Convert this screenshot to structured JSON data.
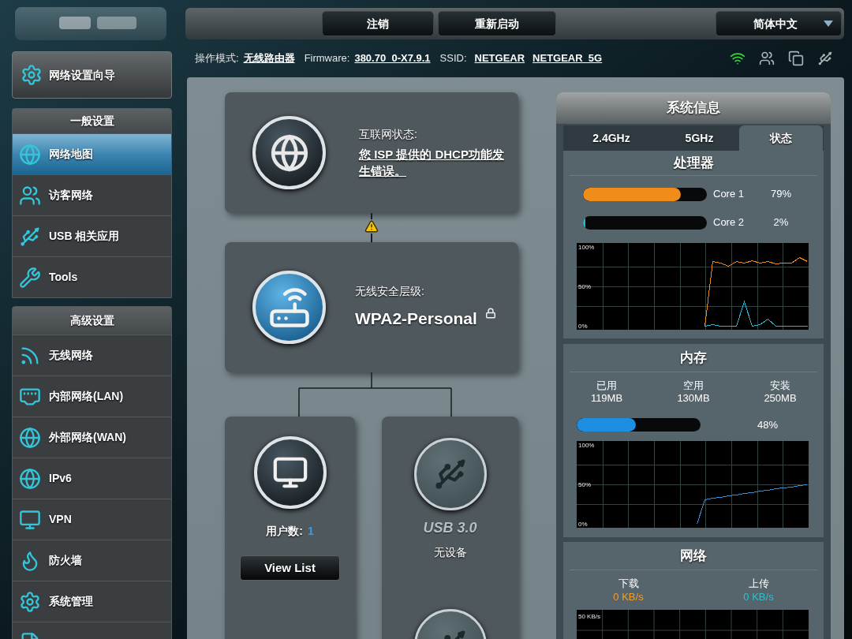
{
  "header": {
    "buttons": [
      "注销",
      "重新启动"
    ],
    "language": "简体中文"
  },
  "info_bar": {
    "mode_label": "操作模式:",
    "mode": "无线路由器",
    "firmware_label": "Firmware:",
    "firmware": "380.70_0-X7.9.1",
    "ssid_label": "SSID:",
    "ssids": [
      "NETGEAR",
      "NETGEAR_5G"
    ],
    "status_icons": [
      {
        "kind": "wifi",
        "active": true
      },
      {
        "kind": "clients",
        "active": false
      },
      {
        "kind": "devices",
        "active": false
      },
      {
        "kind": "usb",
        "active": false
      }
    ]
  },
  "sidebar": {
    "wizard": "网络设置向导",
    "sections": [
      {
        "title": "一般设置",
        "items": [
          {
            "kind": "map",
            "label": "网络地图",
            "selected": true
          },
          {
            "kind": "guest",
            "label": "访客网络",
            "selected": false
          },
          {
            "kind": "usb",
            "label": "USB 相关应用",
            "selected": false
          },
          {
            "kind": "tools",
            "label": "Tools",
            "selected": false
          }
        ]
      },
      {
        "title": "高级设置",
        "items": [
          {
            "kind": "wireless",
            "label": "无线网络",
            "selected": false
          },
          {
            "kind": "lan",
            "label": "内部网络(LAN)",
            "selected": false
          },
          {
            "kind": "wan",
            "label": "外部网络(WAN)",
            "selected": false
          },
          {
            "kind": "ipv6",
            "label": "IPv6",
            "selected": false
          },
          {
            "kind": "vpn",
            "label": "VPN",
            "selected": false
          },
          {
            "kind": "firewall",
            "label": "防火墙",
            "selected": false
          },
          {
            "kind": "admin",
            "label": "系统管理",
            "selected": false
          },
          {
            "kind": "log",
            "selected": false
          }
        ]
      }
    ]
  },
  "network_map": {
    "internet": {
      "label": "互联网状态:",
      "status": "您 ISP 提供的 DHCP功能发生错误。",
      "warning": true
    },
    "router": {
      "label": "无线安全层级:",
      "security": "WPA2-Personal",
      "locked": true
    },
    "clients": {
      "label": "用户数:",
      "count": "1",
      "button": "View List"
    },
    "usb_ports": [
      {
        "kind": "usb",
        "title": "USB 3.0",
        "status": "无设备"
      },
      {
        "kind": "usb"
      }
    ]
  },
  "system_info": {
    "title": "系统信息",
    "tabs": [
      {
        "label": "2.4GHz",
        "selected": false
      },
      {
        "label": "5GHz",
        "selected": false
      },
      {
        "label": "状态",
        "selected": true
      }
    ],
    "cpu": {
      "title": "处理器",
      "cores": [
        {
          "name": "Core 1",
          "level": 0.79,
          "reading": "79%",
          "color": "#f08c1a"
        },
        {
          "name": "Core 2",
          "level": 0.02,
          "reading": "2%",
          "color": "#2ab8d0"
        }
      ],
      "chart_data": {
        "type": "line",
        "grid": true,
        "ylim": [
          -5,
          105
        ],
        "yticks": [
          {
            "value": 0,
            "label": "0%"
          },
          {
            "value": 50,
            "label": "50%"
          },
          {
            "value": 100,
            "label": "100%"
          }
        ],
        "series": [
          {
            "color": "#f08c1a",
            "values": [
              null,
              null,
              null,
              null,
              null,
              null,
              null,
              null,
              null,
              null,
              null,
              null,
              null,
              null,
              null,
              null,
              0,
              82,
              80,
              76,
              82,
              80,
              83,
              80,
              82,
              79,
              80,
              80,
              87,
              82
            ]
          },
          {
            "color": "#2ab8d0",
            "values": [
              null,
              null,
              null,
              null,
              null,
              null,
              null,
              null,
              null,
              null,
              null,
              null,
              null,
              null,
              null,
              null,
              0,
              2,
              0,
              0,
              0,
              31,
              0,
              2,
              9,
              0,
              0,
              0,
              0,
              0
            ]
          }
        ]
      }
    },
    "memory": {
      "title": "内存",
      "stats": [
        {
          "label": "已用",
          "value": "119MB"
        },
        {
          "label": "空用",
          "value": "130MB"
        },
        {
          "label": "安装",
          "value": "250MB"
        }
      ],
      "level": 0.48,
      "reading": "48%",
      "chart_data": {
        "type": "line",
        "grid": true,
        "ylim": [
          -5,
          105
        ],
        "yticks": [
          {
            "value": 0,
            "label": "0%"
          },
          {
            "value": 50,
            "label": "50%"
          },
          {
            "value": 100,
            "label": "100%"
          }
        ],
        "series": [
          {
            "color": "#3a8fd0",
            "values": [
              null,
              null,
              null,
              null,
              null,
              null,
              null,
              null,
              null,
              null,
              null,
              null,
              null,
              null,
              null,
              0,
              31,
              33,
              34,
              36,
              37,
              39,
              40,
              42,
              43,
              45,
              46,
              47,
              49,
              50
            ]
          }
        ]
      }
    },
    "network": {
      "title": "网络",
      "stats": [
        {
          "label": "下载",
          "value": "0 KB/s",
          "color": "#f0a030"
        },
        {
          "label": "上传",
          "value": "0 KB/s",
          "color": "#30c0d0"
        }
      ],
      "chart_label": "50 KB/s"
    }
  }
}
